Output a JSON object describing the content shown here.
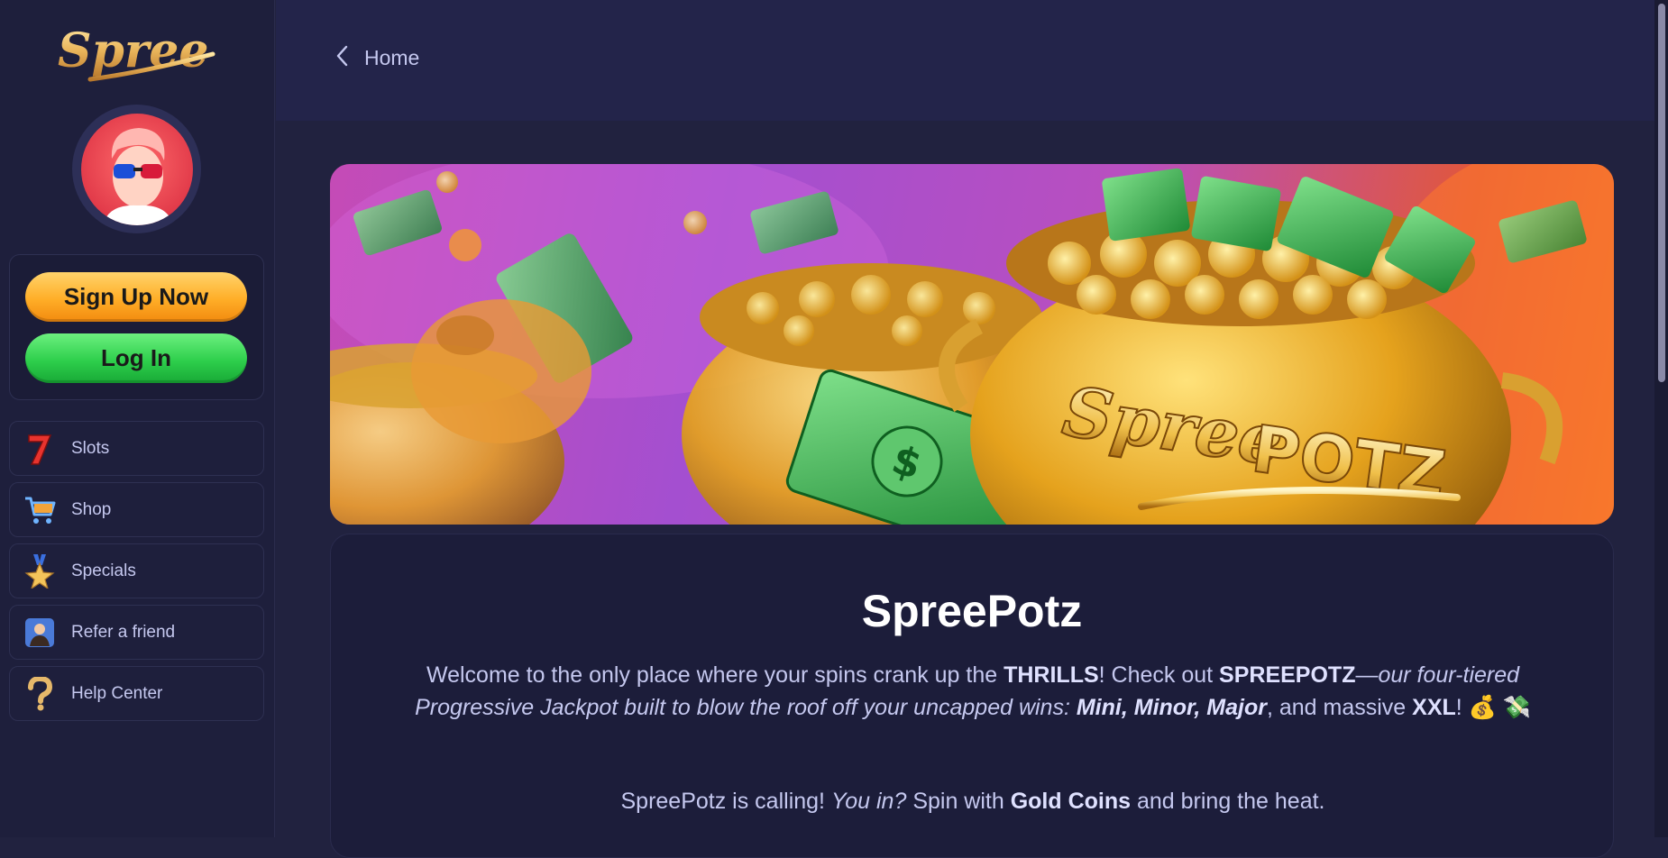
{
  "brand": {
    "logo_text": "Spree"
  },
  "sidebar": {
    "signup_label": "Sign Up Now",
    "login_label": "Log In",
    "items": [
      {
        "label": "Slots",
        "icon": "lucky-seven-icon"
      },
      {
        "label": "Shop",
        "icon": "shopping-cart-icon"
      },
      {
        "label": "Specials",
        "icon": "star-medal-icon"
      },
      {
        "label": "Refer a friend",
        "icon": "user-profile-icon"
      },
      {
        "label": "Help Center",
        "icon": "question-mark-icon"
      }
    ]
  },
  "header": {
    "breadcrumb_label": "Home"
  },
  "banner": {
    "logo_text_1": "Spree",
    "logo_text_2": "POTZ"
  },
  "promo": {
    "title": "SpreePotz",
    "p1_a": "Welcome to the only place where your spins crank up the ",
    "p1_b": "THRILLS",
    "p1_c": "! Check out ",
    "p1_d": "SPREEPOTZ",
    "p1_e": "—",
    "p1_f": "our four-tiered Progressive Jackpot built to blow the roof off your uncapped wins: ",
    "p1_g": "Mini, Minor, Major",
    "p1_h": ", and massive ",
    "p1_i": "XXL",
    "p1_j": "! 💰 💸",
    "p2_a": "SpreePotz is calling! ",
    "p2_b": "You in?",
    "p2_c": " Spin with ",
    "p2_d": "Gold Coins",
    "p2_e": " and bring the heat."
  },
  "colors": {
    "background": "#21223f",
    "sidebar": "#1e1f3c",
    "header": "#23244a",
    "text": "#c5c8ef",
    "signup": "#ffae27",
    "login": "#2ecf4c"
  }
}
